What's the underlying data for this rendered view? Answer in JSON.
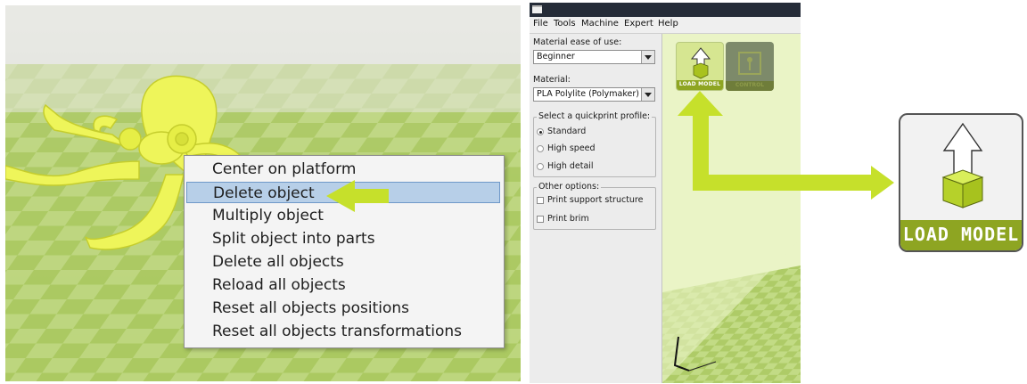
{
  "context_menu": {
    "items": [
      "Center on platform",
      "Delete object",
      "Multiply object",
      "Split object into parts",
      "Delete all objects",
      "Reload all objects",
      "Reset all objects positions",
      "Reset all objects transformations"
    ],
    "selected_index": 1
  },
  "window": {
    "menubar": [
      "File",
      "Tools",
      "Machine",
      "Expert",
      "Help"
    ]
  },
  "sidebar": {
    "ease_label": "Material ease of use:",
    "ease_value": "Beginner",
    "material_label": "Material:",
    "material_value": "PLA Polylite (Polymaker)",
    "profile_group_title": "Select a quickprint profile:",
    "profiles": [
      "Standard",
      "High speed",
      "High detail"
    ],
    "selected_profile": "Standard",
    "other_group_title": "Other options:",
    "options": [
      "Print support structure",
      "Print brim"
    ]
  },
  "toolbar": {
    "load_label": "LOAD MODEL",
    "print_label": "CONTROL"
  },
  "zoom_button": {
    "label": "LOAD MODEL"
  },
  "colors": {
    "accent_green": "#c6e02b",
    "button_green": "#8ea522",
    "selection_blue": "#b7cfe8",
    "model_yellow": "#eef55a"
  },
  "icons": [
    "left-arrow-icon",
    "upload-arrow-icon",
    "cube-icon",
    "printer-icon",
    "pointer-arrow-icon"
  ]
}
